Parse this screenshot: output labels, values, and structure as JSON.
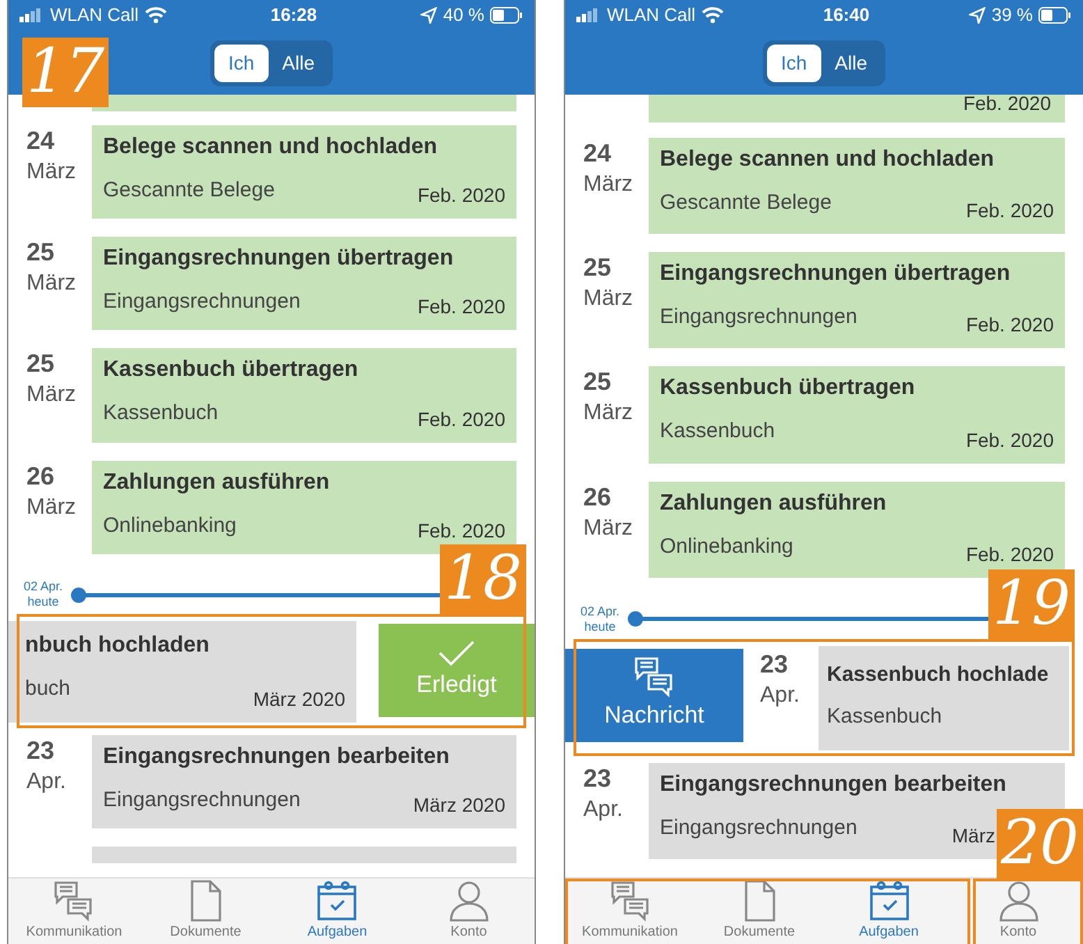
{
  "phones": [
    {
      "status": {
        "carrier": "WLAN Call",
        "time": "16:28",
        "battery": "40 %"
      },
      "segments": [
        {
          "label": "Ich",
          "selected": true
        },
        {
          "label": "Alle",
          "selected": false
        }
      ],
      "header_callout": "17",
      "items": [
        {
          "kind": "partial",
          "done": true
        },
        {
          "kind": "task",
          "day": "24",
          "month": "März",
          "title": "Belege scannen und hochladen",
          "subtitle": "Gescannte Belege",
          "period": "Feb. 2020",
          "done": true
        },
        {
          "kind": "task",
          "day": "25",
          "month": "März",
          "title": "Eingangsrechnungen übertragen",
          "subtitle": "Eingangsrechnungen",
          "period": "Feb. 2020",
          "done": true
        },
        {
          "kind": "task",
          "day": "25",
          "month": "März",
          "title": "Kassenbuch übertragen",
          "subtitle": "Kassenbuch",
          "period": "Feb. 2020",
          "done": true
        },
        {
          "kind": "task",
          "day": "26",
          "month": "März",
          "title": "Zahlungen ausführen",
          "subtitle": "Onlinebanking",
          "period": "Feb. 2020",
          "done": true
        },
        {
          "kind": "today",
          "date": "02 Apr.",
          "label": "heute"
        },
        {
          "kind": "swipe_done",
          "title": "nbuch hochladen",
          "subtitle": "buch",
          "period": "März 2020",
          "action": "Erledigt",
          "callout": "18"
        },
        {
          "kind": "task",
          "day": "23",
          "month": "Apr.",
          "title": "Eingangsrechnungen bearbeiten",
          "subtitle": "Eingangsrechnungen",
          "period": "März 2020",
          "done": false
        },
        {
          "kind": "partial",
          "done": false
        }
      ],
      "tabs": [
        {
          "label": "Kommunikation",
          "selected": false
        },
        {
          "label": "Dokumente",
          "selected": false
        },
        {
          "label": "Aufgaben",
          "selected": true
        },
        {
          "label": "Konto",
          "selected": false
        }
      ]
    },
    {
      "status": {
        "carrier": "WLAN Call",
        "time": "16:40",
        "battery": "39 %"
      },
      "segments": [
        {
          "label": "Ich",
          "selected": true
        },
        {
          "label": "Alle",
          "selected": false
        }
      ],
      "items": [
        {
          "kind": "partial",
          "done": true,
          "period": "Feb. 2020"
        },
        {
          "kind": "task",
          "day": "24",
          "month": "März",
          "title": "Belege scannen und hochladen",
          "subtitle": "Gescannte Belege",
          "period": "Feb. 2020",
          "done": true
        },
        {
          "kind": "task",
          "day": "25",
          "month": "März",
          "title": "Eingangsrechnungen übertragen",
          "subtitle": "Eingangsrechnungen",
          "period": "Feb. 2020",
          "done": true
        },
        {
          "kind": "task",
          "day": "25",
          "month": "März",
          "title": "Kassenbuch übertragen",
          "subtitle": "Kassenbuch",
          "period": "Feb. 2020",
          "done": true
        },
        {
          "kind": "task",
          "day": "26",
          "month": "März",
          "title": "Zahlungen ausführen",
          "subtitle": "Onlinebanking",
          "period": "Feb. 2020",
          "done": true
        },
        {
          "kind": "today",
          "date": "02 Apr.",
          "label": "heute"
        },
        {
          "kind": "swipe_message",
          "action": "Nachricht",
          "day": "23",
          "month": "Apr.",
          "title": "Kassenbuch hochlade",
          "subtitle": "Kassenbuch",
          "callout": "19"
        },
        {
          "kind": "task",
          "day": "23",
          "month": "Apr.",
          "title": "Eingangsrechnungen bearbeiten",
          "subtitle": "Eingangsrechnungen",
          "period": "März",
          "done": false
        }
      ],
      "tabbar_callout": "20",
      "tabs": [
        {
          "label": "Kommunikation",
          "selected": false
        },
        {
          "label": "Dokumente",
          "selected": false
        },
        {
          "label": "Aufgaben",
          "selected": true
        },
        {
          "label": "Konto",
          "selected": false
        }
      ]
    }
  ]
}
